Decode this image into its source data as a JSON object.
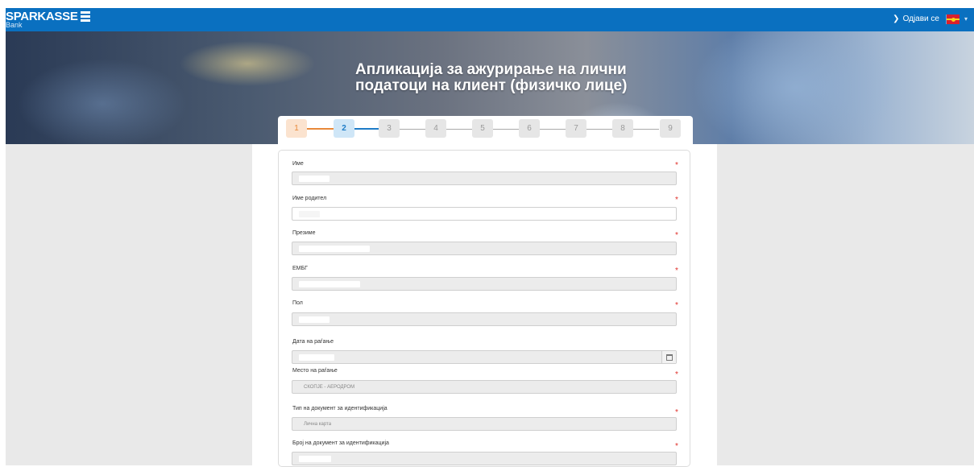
{
  "header": {
    "brand": "SPARKASSE",
    "brand_sub": "Bank",
    "logout_label": "Одјави се",
    "colors": {
      "bar": "#0a70c0",
      "required": "#e0302a"
    }
  },
  "hero": {
    "title": "Апликација за ажурирање на лични податоци на клиент (физичко лице)"
  },
  "stepper": {
    "steps": [
      "1",
      "2",
      "3",
      "4",
      "5",
      "6",
      "7",
      "8",
      "9"
    ],
    "current_step": 2
  },
  "form": {
    "fields": [
      {
        "label": "Име",
        "value": ""
      },
      {
        "label": "Име родител",
        "value": ""
      },
      {
        "label": "Презиме",
        "value": ""
      },
      {
        "label": "ЕМБГ",
        "value": ""
      },
      {
        "label": "Пол",
        "value": ""
      },
      {
        "label": "Дата на раѓање",
        "value": ""
      },
      {
        "label": "Место на раѓање",
        "value": "СКОПЈЕ - АЕРОДРОМ"
      },
      {
        "label": "Тип на документ за идентификација",
        "value": "Лична карта"
      },
      {
        "label": "Број на документ за идентификација",
        "value": ""
      }
    ]
  }
}
